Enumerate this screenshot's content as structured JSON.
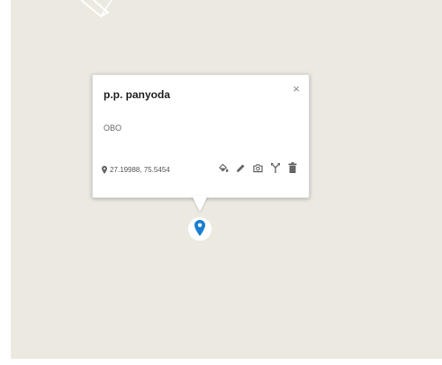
{
  "map": {
    "background_color": "#ece9e1",
    "marker_color": "#1a7fd1"
  },
  "popup": {
    "title": "p.p. panyoda",
    "close_label": "×",
    "description": "OBO",
    "coordinates": "27.19988, 75.5454",
    "toolbar": [
      "fill-color-icon",
      "edit-icon",
      "camera-icon",
      "directions-icon",
      "delete-icon"
    ]
  }
}
